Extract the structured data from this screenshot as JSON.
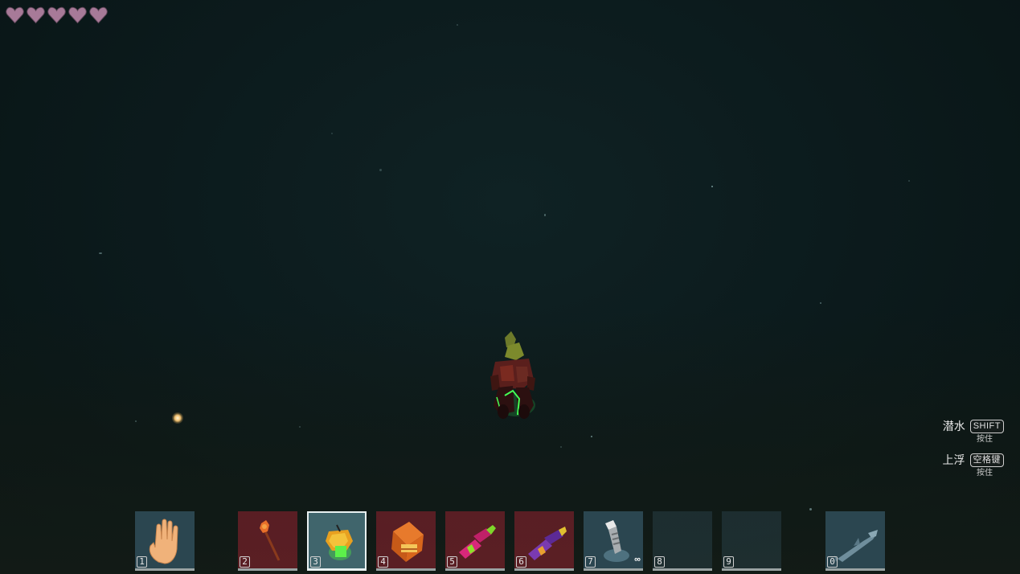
{
  "hud": {
    "health": {
      "current": 5,
      "max": 5,
      "heart_color": "#a77a98"
    }
  },
  "controls": {
    "dive": {
      "label": "潜水",
      "key": "SHIFT",
      "hint": "按住"
    },
    "surface": {
      "label": "上浮",
      "key": "空格键",
      "hint": "按住"
    }
  },
  "hotbar": {
    "selected_slot": 3,
    "slots": [
      {
        "number": "1",
        "item_icon": "hand-icon",
        "bg": "blue"
      },
      {
        "number": "2",
        "item_icon": "torch-staff-icon",
        "bg": "red"
      },
      {
        "number": "3",
        "item_icon": "lantern-icon",
        "bg": "selected"
      },
      {
        "number": "4",
        "item_icon": "crate-icon",
        "bg": "red"
      },
      {
        "number": "5",
        "item_icon": "pink-blaster-icon",
        "bg": "red"
      },
      {
        "number": "6",
        "item_icon": "purple-blaster-icon",
        "bg": "red"
      },
      {
        "number": "7",
        "item_icon": "flashlight-icon",
        "bg": "blue",
        "count": "∞"
      },
      {
        "number": "8",
        "item_icon": "",
        "bg": "dark"
      },
      {
        "number": "9",
        "item_icon": "",
        "bg": "dark"
      },
      {
        "number": "0",
        "item_icon": "hammerhead-shark-icon",
        "bg": "blue"
      }
    ]
  }
}
